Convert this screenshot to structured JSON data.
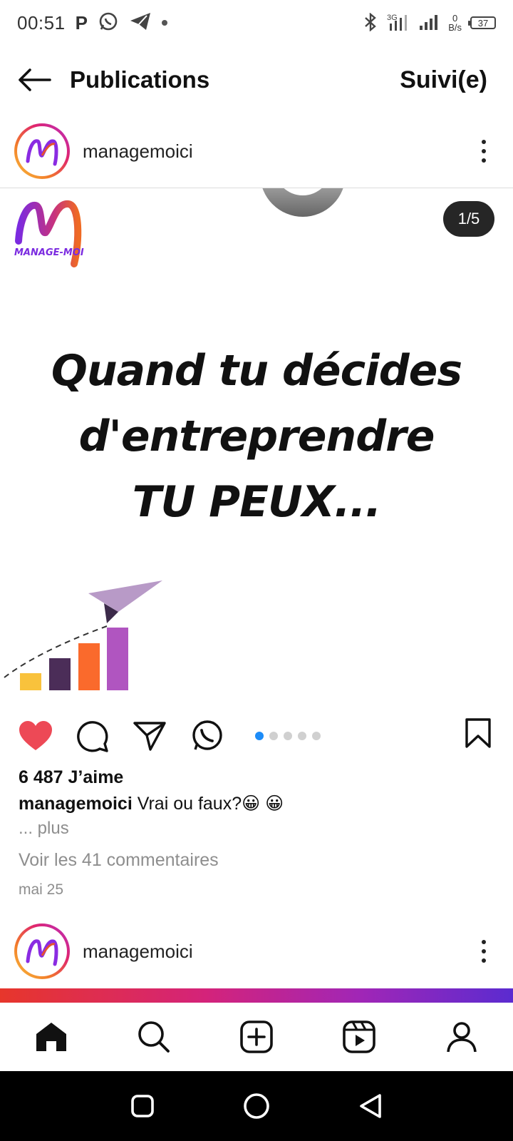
{
  "status_bar": {
    "time": "00:51",
    "p_label": "P",
    "net_speed_value": "0",
    "net_speed_unit": "B/s",
    "battery": "37",
    "network": "3G"
  },
  "header": {
    "title": "Publications",
    "follow_label": "Suivi(e)"
  },
  "post": {
    "username": "managemoici",
    "page_counter": "1/5",
    "brand_logo_text": "MANAGE-MOI",
    "headline_lines": [
      "Quand tu décides",
      "d'entreprendre",
      "TU PEUX..."
    ],
    "likes": "6 487 J’aime",
    "caption_user": "managemoici",
    "caption_text": " Vrai ou faux?😀 😀",
    "more_label": "... plus",
    "comments_label": "Voir les 41 commentaires",
    "date": "mai 25",
    "carousel_total": 5,
    "carousel_active": 1,
    "liked": true,
    "like_color": "#ed4956"
  },
  "next_post": {
    "username": "managemoici"
  },
  "bottom_nav": [
    "home-icon",
    "search-icon",
    "new-post-icon",
    "reels-icon",
    "profile-icon"
  ],
  "android_nav": [
    "recents-icon",
    "home-circle-icon",
    "back-triangle-icon"
  ]
}
